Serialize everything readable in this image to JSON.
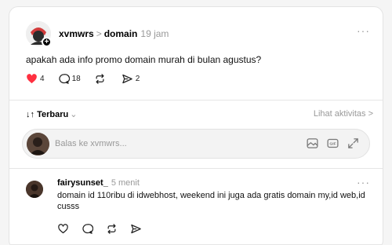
{
  "post": {
    "username": "xvmwrs",
    "separator": ">",
    "topic": "domain",
    "time": "19 jam",
    "more": "···",
    "text": "apakah ada info promo domain murah di bulan agustus?",
    "likes": "4",
    "comments": "18",
    "shares": "2",
    "like_color": "#ff3040"
  },
  "sort": {
    "label": "Terbaru",
    "activity_link": "Lihat aktivitas >"
  },
  "reply": {
    "placeholder": "Balas ke xvmwrs..."
  },
  "comment": {
    "username": "fairysunset_",
    "time": "5 menit",
    "more": "···",
    "text": "domain id 110ribu di idwebhost, weekend ini juga ada gratis domain my,id web,id cusss"
  }
}
